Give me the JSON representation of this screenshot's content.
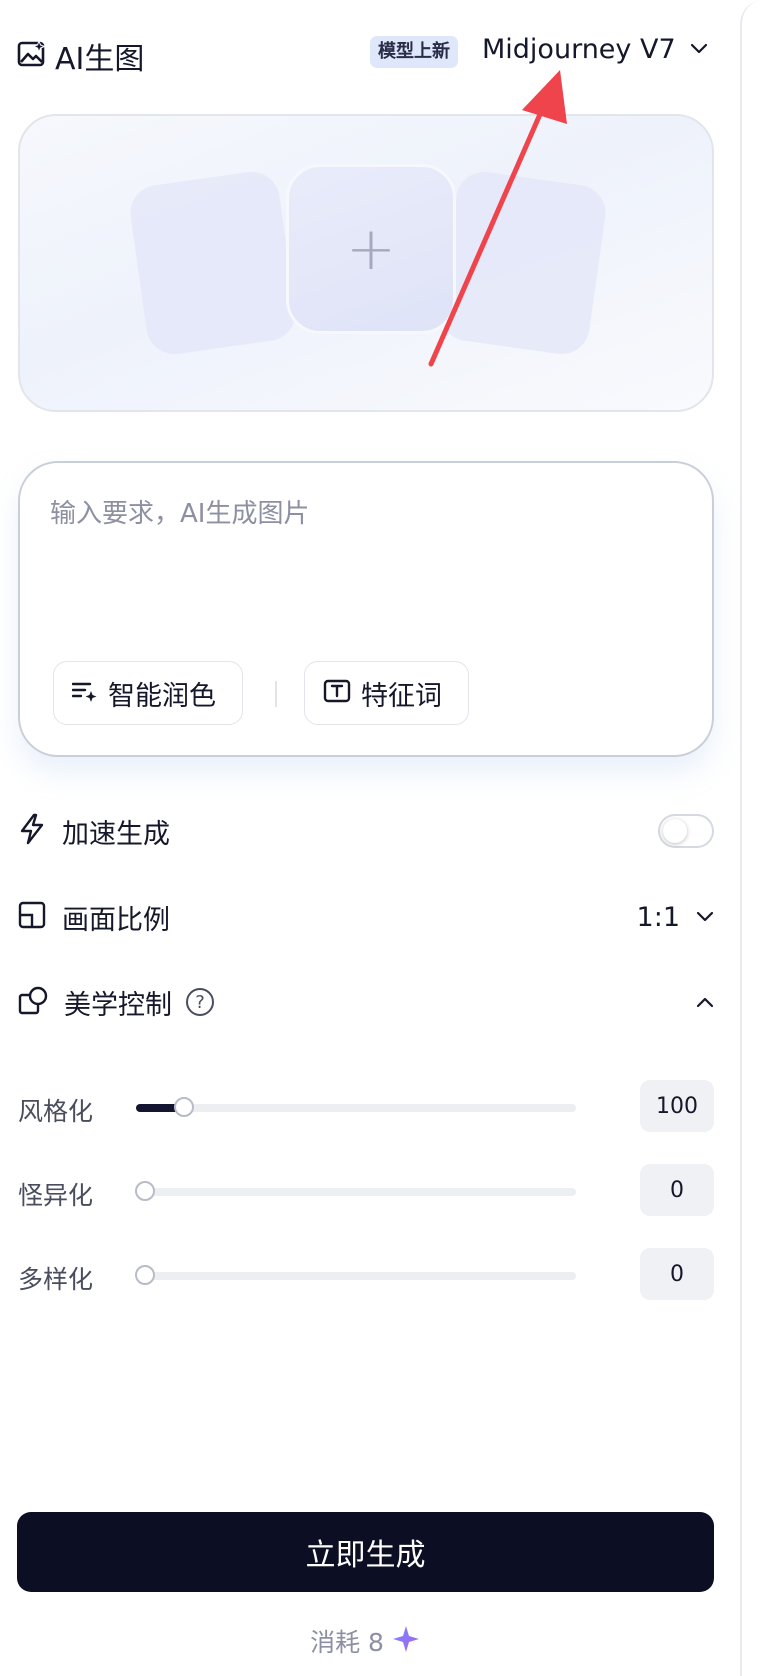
{
  "header": {
    "title": "AI生图",
    "badge": "模型上新",
    "model_name": "Midjourney V7"
  },
  "upload": {
    "plus_symbol": "+"
  },
  "prompt": {
    "placeholder": "输入要求，AI生成图片",
    "value": "",
    "polish_label": "智能润色",
    "keywords_label": "特征词"
  },
  "options": {
    "speed_label": "加速生成",
    "speed_on": false,
    "ratio_label": "画面比例",
    "ratio_value": "1:1",
    "aesthetics_label": "美学控制",
    "help_symbol": "?"
  },
  "sliders": [
    {
      "label": "风格化",
      "value": "100",
      "position": 0.11
    },
    {
      "label": "怪异化",
      "value": "0",
      "position": 0
    },
    {
      "label": "多样化",
      "value": "0",
      "position": 0
    }
  ],
  "footer": {
    "generate_label": "立即生成",
    "cost_label": "消耗 8"
  },
  "icons": {
    "header": "image-sparkle-icon",
    "model_dropdown": "chevron-down-icon",
    "polish": "text-sparkle-icon",
    "keywords": "text-box-icon",
    "speed": "lightning-icon",
    "ratio": "aspect-ratio-icon",
    "ratio_dropdown": "chevron-down-icon",
    "aesthetics": "shapes-icon",
    "aesthetics_collapse": "chevron-up-icon",
    "cost": "sparkle-icon"
  },
  "colors": {
    "primary_button": "#0c0e24",
    "badge_bg": "#dfe7fb",
    "annotation_arrow": "#f0444c",
    "cost_sparkle": "#8b6cf5"
  }
}
